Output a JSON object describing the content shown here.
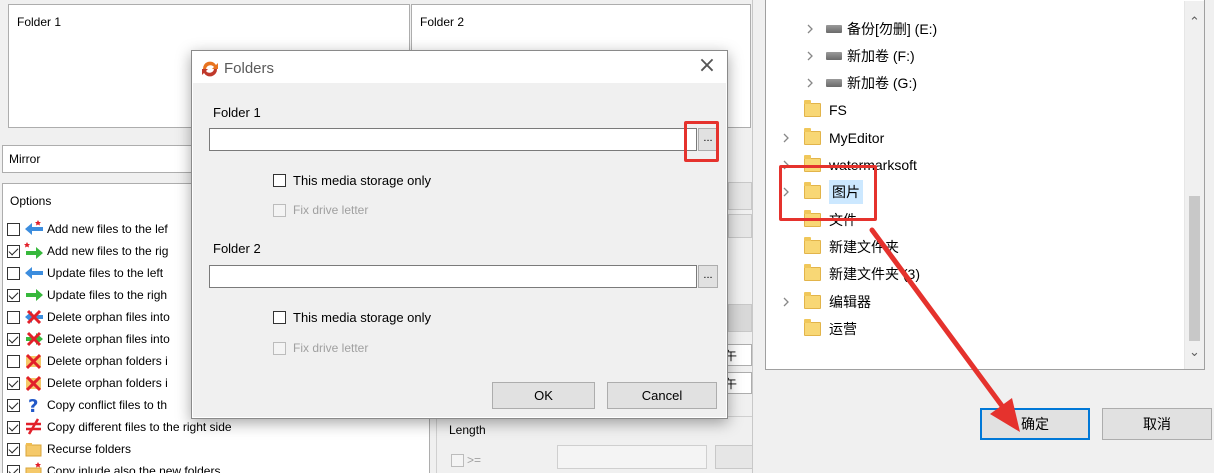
{
  "main": {
    "folder1_label": "Folder 1",
    "folder2_label": "Folder 2",
    "mode": "Mirror",
    "options_title": "Options",
    "options": [
      {
        "label": "Add new files to the lef",
        "checked": false,
        "icon": "arrow-left-blue-star-icon"
      },
      {
        "label": "Add new files to the rig",
        "checked": true,
        "icon": "arrow-right-green-star-icon"
      },
      {
        "label": "Update files to the left",
        "checked": false,
        "icon": "arrow-left-blue-icon"
      },
      {
        "label": "Update files to the righ",
        "checked": true,
        "icon": "arrow-right-green-icon"
      },
      {
        "label": "Delete orphan files into",
        "checked": false,
        "icon": "delete-orphan-left-icon"
      },
      {
        "label": "Delete orphan files into",
        "checked": true,
        "icon": "delete-orphan-right-icon"
      },
      {
        "label": "Delete orphan folders i",
        "checked": false,
        "icon": "delete-orphan-folder-left-icon"
      },
      {
        "label": "Delete orphan folders i",
        "checked": true,
        "icon": "delete-orphan-folder-right-icon"
      },
      {
        "label": "Copy conflict files to th",
        "checked": true,
        "icon": "question-mark-icon"
      },
      {
        "label": "Copy different files to the right side",
        "checked": true,
        "icon": "not-equal-icon"
      },
      {
        "label": "Recurse folders",
        "checked": true,
        "icon": "folder-icon"
      },
      {
        "label": "Copy inlude also the new folders",
        "checked": true,
        "icon": "folder-new-icon"
      }
    ],
    "length_label": "Length",
    "length_op": ">=",
    "fragment_1": "午",
    "fragment_2": "午"
  },
  "dialog": {
    "title": "Folders",
    "folder1_label": "Folder 1",
    "folder1_value": "",
    "folder2_label": "Folder 2",
    "folder2_value": "",
    "browse_label": "...",
    "media_only_label": "This media storage only",
    "fix_drive_label": "Fix drive letter",
    "ok_label": "OK",
    "cancel_label": "Cancel",
    "close_glyph": "×"
  },
  "tree": {
    "items": [
      {
        "label": "备份[勿删] (E:)",
        "type": "drive",
        "expandable": true
      },
      {
        "label": "新加卷 (F:)",
        "type": "drive",
        "expandable": true
      },
      {
        "label": "新加卷 (G:)",
        "type": "drive",
        "expandable": true
      },
      {
        "label": "FS",
        "type": "folder",
        "expandable": false
      },
      {
        "label": "MyEditor",
        "type": "folder",
        "expandable": true
      },
      {
        "label": "watermarksoft",
        "type": "folder",
        "expandable": true
      },
      {
        "label": "图片",
        "type": "folder",
        "expandable": true,
        "selected": true
      },
      {
        "label": "文件",
        "type": "folder",
        "expandable": false
      },
      {
        "label": "新建文件夹",
        "type": "folder",
        "expandable": false
      },
      {
        "label": "新建文件夹 (3)",
        "type": "folder",
        "expandable": false
      },
      {
        "label": "编辑器",
        "type": "folder",
        "expandable": true
      },
      {
        "label": "运营",
        "type": "folder",
        "expandable": false
      }
    ],
    "ok_label": "确定",
    "cancel_label": "取消"
  },
  "colors": {
    "highlight": "#e5322d",
    "selection": "#cce8ff",
    "primary_border": "#0078d7"
  }
}
